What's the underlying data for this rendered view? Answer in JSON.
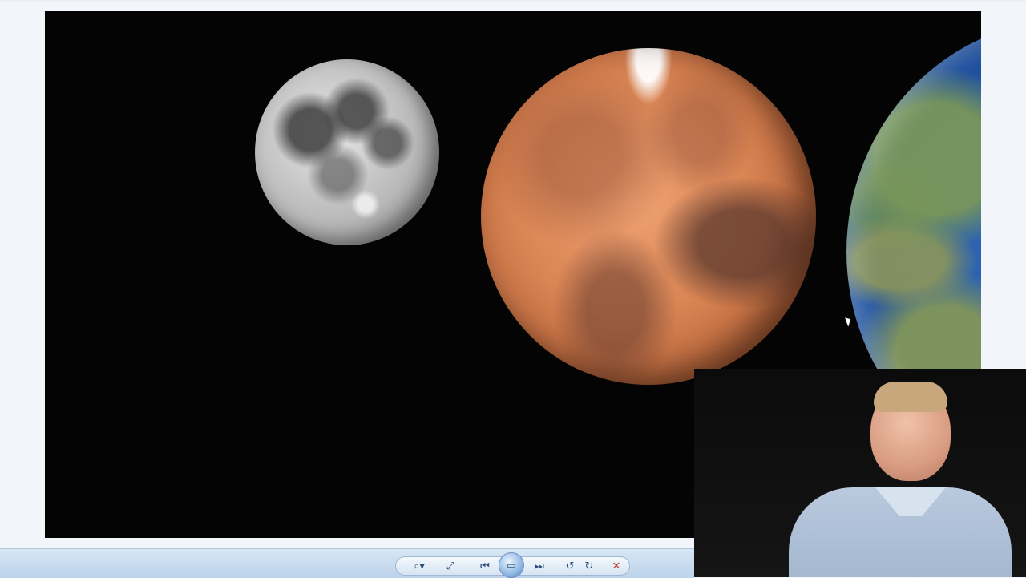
{
  "viewer": {
    "images": [
      {
        "name": "moon"
      },
      {
        "name": "mars"
      },
      {
        "name": "earth"
      }
    ]
  },
  "controls": {
    "items": [
      {
        "name": "zoom-icon",
        "label": "⌕▾"
      },
      {
        "name": "fit-icon",
        "label": "⤢"
      },
      {
        "name": "previous-icon",
        "label": "⏮"
      },
      {
        "name": "slideshow-icon",
        "label": "▭"
      },
      {
        "name": "next-icon",
        "label": "⏭"
      },
      {
        "name": "rotate-left-icon",
        "label": "↺"
      },
      {
        "name": "rotate-right-icon",
        "label": "↻"
      },
      {
        "name": "delete-icon",
        "label": "✕"
      }
    ],
    "colors": {
      "accent": "#2a4f7c",
      "delete": "#c83b3b"
    }
  },
  "webcam": {
    "present": true
  }
}
